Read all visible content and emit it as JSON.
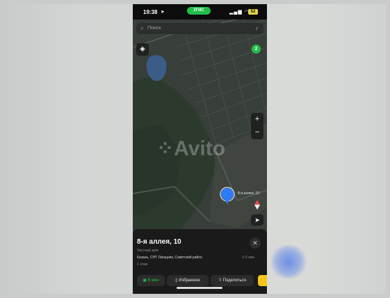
{
  "status_bar": {
    "time": "19:38",
    "app_pill": "2ГИС",
    "battery": "52"
  },
  "search": {
    "placeholder": "Поиск"
  },
  "map": {
    "badge_count": "2",
    "zoom_in": "+",
    "zoom_out": "−",
    "watermark": "Avito",
    "pin_label": "8-я аллея, 10"
  },
  "card": {
    "title": "8-я аллея, 10",
    "type": "Частный дом",
    "address": "Казань, СНТ Овощник, Советский район",
    "distance": "6 мин",
    "floors": "1 этаж",
    "close": "✕",
    "buttons": {
      "route": "6 мин",
      "favorites": "Избранное",
      "share": "Поделиться"
    }
  },
  "colors": {
    "accent_green": "#1fbe4b",
    "pin_blue": "#2e7bf6",
    "yellow": "#f5c518"
  }
}
